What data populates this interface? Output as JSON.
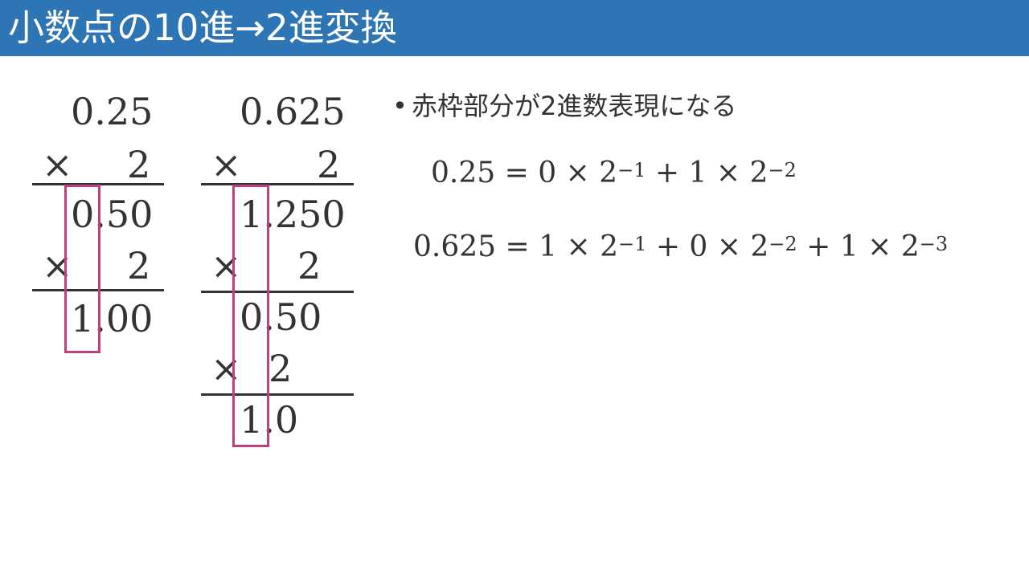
{
  "slide": {
    "title": "小数点の10進→2進変換"
  },
  "calc1": {
    "multiplicand": "0.25",
    "times1": "×",
    "multiplier1": "2",
    "result1": "0.50",
    "times2": "×",
    "multiplier2": "2",
    "result2": "1.00"
  },
  "calc2": {
    "multiplicand": "0.625",
    "times1": "×",
    "multiplier1": "2",
    "result1": "1.250",
    "times2": "×",
    "multiplier2": "2",
    "result2": "0.50",
    "times3": "×",
    "multiplier3": "2",
    "result3": "1.0"
  },
  "notes": {
    "bullet": "•",
    "text": "赤枠部分が2進数表現になる"
  },
  "equations": {
    "eq1": {
      "lhs": "0.25 = 0 × 2",
      "exp1": "−1",
      "mid": " + 1 × 2",
      "exp2": "−2"
    },
    "eq2": {
      "lhs": "0.625 = 1 × 2",
      "exp1": "−1",
      "mid1": " + 0 × 2",
      "exp2": "−2",
      "mid2": " + 1 × 2",
      "exp3": "−3"
    }
  },
  "colors": {
    "header": "#2E75B6",
    "highlight": "#C0407E",
    "text": "#333333"
  }
}
